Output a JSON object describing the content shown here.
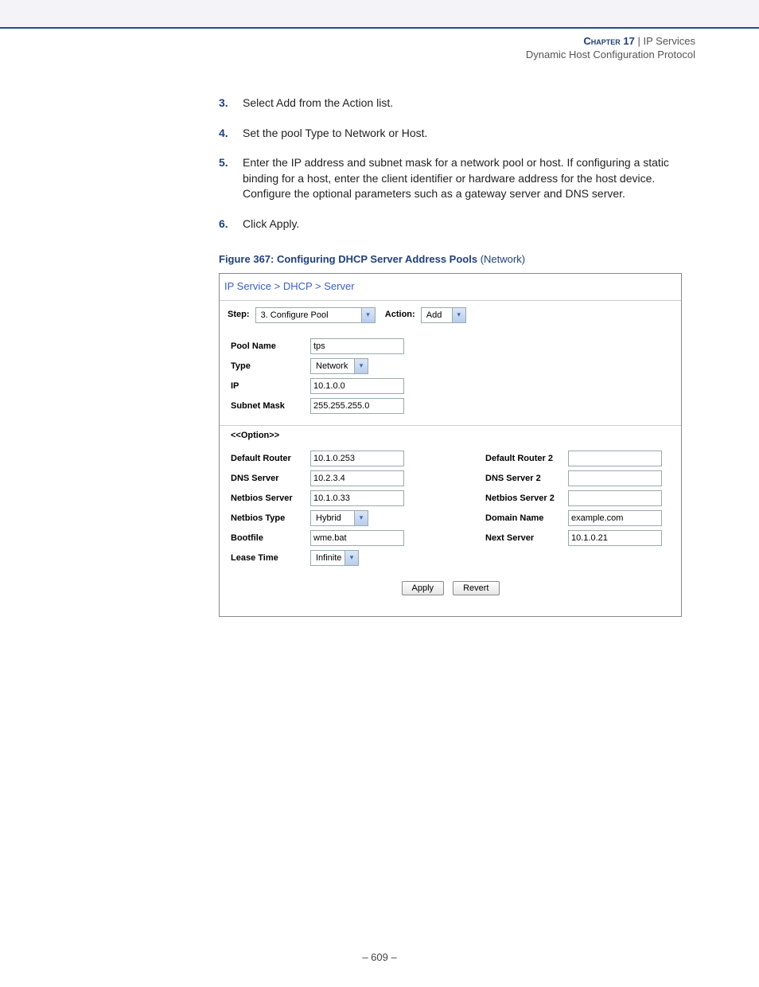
{
  "header": {
    "chapter_label": "Chapter 17",
    "separator": "  |  ",
    "title": "IP Services",
    "subtitle": "Dynamic Host Configuration Protocol"
  },
  "steps": [
    {
      "num": "3.",
      "text": "Select Add from the Action list."
    },
    {
      "num": "4.",
      "text": "Set the pool Type to Network or Host."
    },
    {
      "num": "5.",
      "text": "Enter the IP address and subnet mask for a network pool or host. If configuring a static binding for a host, enter the client identifier or hardware address for the host device. Configure the optional parameters such as a gateway server and DNS server."
    },
    {
      "num": "6.",
      "text": "Click Apply."
    }
  ],
  "figure": {
    "caption_bold": "Figure 367:  Configuring DHCP Server Address Pools ",
    "caption_suffix": "(Network)"
  },
  "screenshot": {
    "breadcrumb": "IP Service > DHCP > Server",
    "toolbar": {
      "step_label": "Step:",
      "step_value": "3. Configure Pool",
      "action_label": "Action:",
      "action_value": "Add"
    },
    "fields": {
      "pool_name_label": "Pool Name",
      "pool_name_value": "tps",
      "type_label": "Type",
      "type_value": "Network",
      "ip_label": "IP",
      "ip_value": "10.1.0.0",
      "subnet_label": "Subnet Mask",
      "subnet_value": "255.255.255.0",
      "option_header": "<<Option>>",
      "default_router_label": "Default Router",
      "default_router_value": "10.1.0.253",
      "default_router2_label": "Default Router 2",
      "default_router2_value": "",
      "dns_label": "DNS Server",
      "dns_value": "10.2.3.4",
      "dns2_label": "DNS Server 2",
      "dns2_value": "",
      "netbios_label": "Netbios Server",
      "netbios_value": "10.1.0.33",
      "netbios2_label": "Netbios Server 2",
      "netbios2_value": "",
      "netbios_type_label": "Netbios Type",
      "netbios_type_value": "Hybrid",
      "domain_label": "Domain Name",
      "domain_value": "example.com",
      "bootfile_label": "Bootfile",
      "bootfile_value": "wme.bat",
      "next_server_label": "Next Server",
      "next_server_value": "10.1.0.21",
      "lease_label": "Lease Time",
      "lease_value": "Infinite"
    },
    "buttons": {
      "apply": "Apply",
      "revert": "Revert"
    }
  },
  "footer": {
    "page": "–  609  –"
  }
}
